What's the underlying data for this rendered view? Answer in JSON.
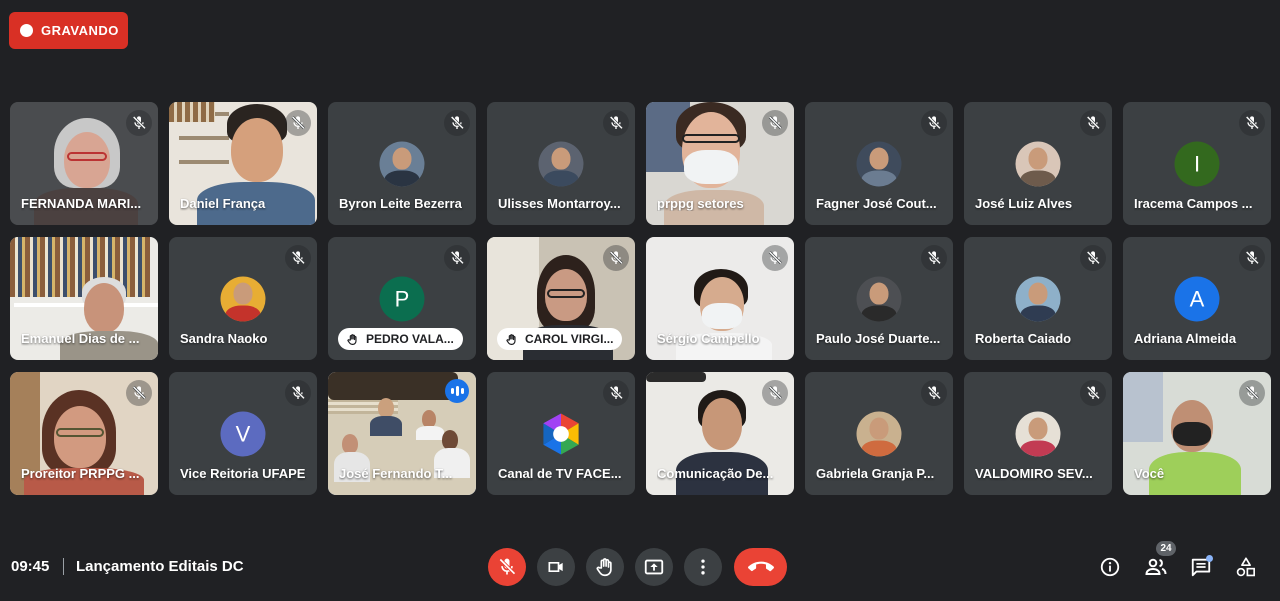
{
  "recording": {
    "label": "GRAVANDO"
  },
  "participants": [
    {
      "name": "FERNANDA MARI...",
      "kind": "video",
      "scene": "woman-gray",
      "mic": "muted"
    },
    {
      "name": "Daniel França",
      "kind": "video",
      "scene": "man-bookshelf",
      "mic": "muted"
    },
    {
      "name": "Byron Leite Bezerra",
      "kind": "photo",
      "mic": "muted"
    },
    {
      "name": "Ulisses Montarroy...",
      "kind": "photo",
      "mic": "muted"
    },
    {
      "name": "prppg setores",
      "kind": "video",
      "scene": "woman-mask",
      "mic": "muted"
    },
    {
      "name": "Fagner José Cout...",
      "kind": "photo",
      "mic": "muted"
    },
    {
      "name": "José Luiz Alves",
      "kind": "photo",
      "mic": "muted"
    },
    {
      "name": "Iracema Campos ...",
      "kind": "letter",
      "letter": "I",
      "color": "#33691e",
      "mic": "muted"
    },
    {
      "name": "Emanuel Dias de ...",
      "kind": "video",
      "scene": "man-library",
      "mic": "none"
    },
    {
      "name": "Sandra Naoko",
      "kind": "photo",
      "mic": "muted"
    },
    {
      "name": "PEDRO VALA...",
      "kind": "letter",
      "letter": "P",
      "color": "#0b6e4f",
      "mic": "muted",
      "hand_raised": true
    },
    {
      "name": "CAROL VIRGI...",
      "kind": "video",
      "scene": "woman-window",
      "mic": "muted",
      "hand_raised": true
    },
    {
      "name": "Sérgio Campello",
      "kind": "video",
      "scene": "man-mask",
      "mic": "muted"
    },
    {
      "name": "Paulo José Duarte...",
      "kind": "photo",
      "mic": "muted"
    },
    {
      "name": "Roberta Caiado",
      "kind": "photo",
      "mic": "muted"
    },
    {
      "name": "Adriana Almeida",
      "kind": "letter",
      "letter": "A",
      "color": "#1a73e8",
      "mic": "muted"
    },
    {
      "name": "Proreitor PRPPG ...",
      "kind": "video",
      "scene": "woman-office",
      "mic": "muted"
    },
    {
      "name": "Vice Reitoria UFAPE",
      "kind": "letter",
      "letter": "V",
      "color": "#5c6bc0",
      "mic": "muted"
    },
    {
      "name": "José Fernando T...",
      "kind": "video",
      "scene": "meeting-room",
      "mic": "speaking",
      "active": true
    },
    {
      "name": "Canal de TV FACE...",
      "kind": "logo",
      "mic": "muted"
    },
    {
      "name": "Comunicação De...",
      "kind": "video",
      "scene": "man-suit",
      "mic": "muted"
    },
    {
      "name": "Gabriela Granja P...",
      "kind": "photo",
      "mic": "muted"
    },
    {
      "name": "VALDOMIRO SEV...",
      "kind": "photo",
      "mic": "muted"
    },
    {
      "name": "Você",
      "kind": "video",
      "scene": "self-mask",
      "mic": "muted"
    }
  ],
  "bottom": {
    "time": "09:45",
    "meeting_title": "Lançamento Editais DC",
    "participant_count": "24"
  },
  "icons": {
    "mic": "mic-off-icon",
    "camera": "videocam-icon",
    "hand": "raise-hand-icon",
    "present": "present-screen-icon",
    "more": "more-vert-icon",
    "hangup": "call-end-icon",
    "info": "info-icon",
    "people": "people-icon",
    "chat": "chat-icon",
    "activities": "activities-icon"
  },
  "colors": {
    "background": "#202124",
    "tile": "#3c4043",
    "record": "#d93025",
    "danger": "#ea4335",
    "accent": "#8ab4f8"
  }
}
